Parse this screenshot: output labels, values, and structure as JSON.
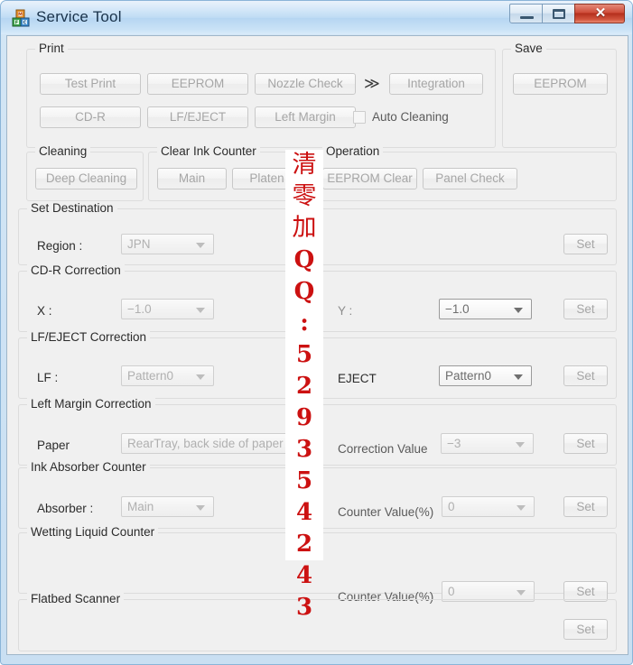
{
  "window": {
    "title": "Service Tool",
    "icon": "blocks-icon",
    "controls": {
      "minimize": "minimize-icon",
      "maximize": "maximize-icon",
      "close_label": "✕"
    }
  },
  "watermark": {
    "text": "清零加QQ:529354243",
    "color": "#cc1111",
    "chars": [
      "清",
      "零",
      "加",
      "Q",
      "Q",
      ":",
      "5",
      "2",
      "9",
      "3",
      "5",
      "4",
      "2",
      "4",
      "3"
    ]
  },
  "groups": {
    "print": {
      "legend": "Print",
      "buttons": [
        {
          "label": "Test Print"
        },
        {
          "label": "EEPROM"
        },
        {
          "label": "Nozzle Check"
        },
        {
          "label": "Integration"
        },
        {
          "label": "CD-R"
        },
        {
          "label": "LF/EJECT"
        },
        {
          "label": "Left Margin"
        }
      ],
      "chevron": "≫",
      "auto_cleaning_label": "Auto Cleaning",
      "auto_cleaning_checked": false
    },
    "save": {
      "legend": "Save",
      "button_label": "EEPROM"
    },
    "cleaning": {
      "legend": "Cleaning",
      "button_label": "Deep Cleaning"
    },
    "clear_ink_counter": {
      "legend": "Clear Ink Counter",
      "buttons": [
        {
          "label": "Main"
        },
        {
          "label": "Platen"
        }
      ]
    },
    "operation": {
      "legend": "Operation",
      "buttons": [
        {
          "label": "EEPROM Clear"
        },
        {
          "label": "Panel Check"
        }
      ]
    },
    "set_destination": {
      "legend": "Set Destination",
      "field_label": "Region :",
      "value": "JPN",
      "set_label": "Set"
    },
    "cdr_correction": {
      "legend": "CD-R Correction",
      "x_label": "X :",
      "x_value": "−1.0",
      "y_label": "Y :",
      "y_value": "−1.0",
      "set_label": "Set"
    },
    "lf_eject_correction": {
      "legend": "LF/EJECT Correction",
      "lf_label": "LF :",
      "lf_value": "Pattern0",
      "eject_label": "EJECT",
      "eject_value": "Pattern0",
      "set_label": "Set"
    },
    "left_margin_correction": {
      "legend": "Left Margin Correction",
      "paper_label": "Paper",
      "paper_value": "RearTray, back side of paper",
      "correction_label": "Correction Value",
      "correction_value": "−3",
      "set_label": "Set"
    },
    "ink_absorber_counter": {
      "legend": "Ink Absorber Counter",
      "absorber_label": "Absorber :",
      "absorber_value": "Main",
      "counter_label": "Counter Value(%)",
      "counter_value": "0",
      "set_label": "Set"
    },
    "wetting_liquid_counter": {
      "legend": "Wetting Liquid Counter",
      "counter_label": "Counter Value(%)",
      "counter_value": "0",
      "set_label": "Set"
    },
    "flatbed_scanner": {
      "legend": "Flatbed Scanner",
      "set_label": "Set"
    }
  }
}
